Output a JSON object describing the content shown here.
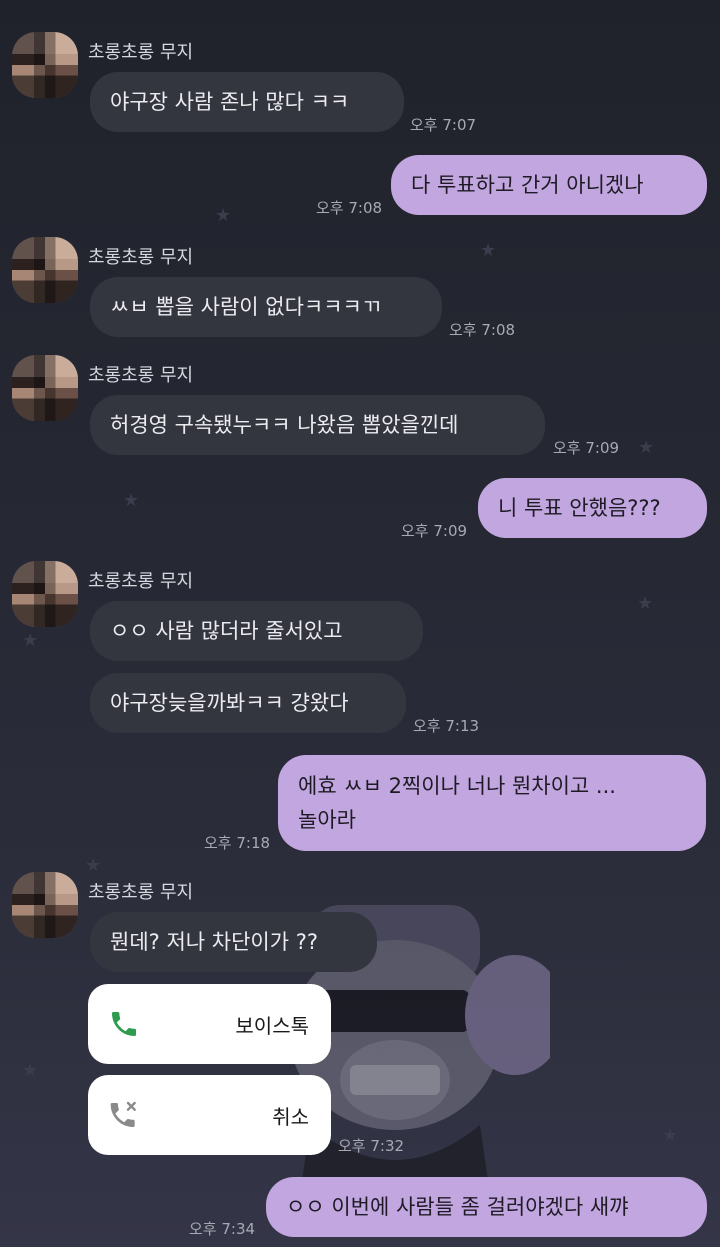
{
  "sender_name": "초롱초롱 무지",
  "messages": [
    {
      "text": "야구장 사람 존나 많다 ㅋㅋ",
      "time": "오후 7:07"
    },
    {
      "text": "다 투표하고 간거 아니겠나",
      "time": "오후 7:08"
    },
    {
      "text": "ㅆㅂ 뽑을 사람이 없다ㅋㅋㅋㄲ",
      "time": "오후 7:08"
    },
    {
      "text": "허경영 구속됐누ㅋㅋ  나왔음 뽑았을낀데",
      "time": "오후 7:09"
    },
    {
      "text": "니 투표 안했음???",
      "time": "오후 7:09"
    },
    {
      "text": "ㅇㅇ  사람 많더라 줄서있고"
    },
    {
      "text": "야구장늦을까봐ㅋㅋ 걍왔다",
      "time": "오후 7:13"
    },
    {
      "line1": "에효  ㅆㅂ  2찍이나 너나  뭔차이고 ...",
      "line2": "놀아라",
      "time": "오후 7:18"
    },
    {
      "text": "뭔데?  저나 차단이가 ??"
    },
    {
      "text": "ㅇㅇ 이번에 사람들 좀 걸러야겠다  새꺄",
      "time": "오후 7:34"
    }
  ],
  "calls": [
    {
      "label": "보이스톡",
      "icon": "phone-icon",
      "color": "#2e9b4f"
    },
    {
      "label": "취소",
      "icon": "missed-call-icon",
      "color": "#8a8a8a"
    }
  ],
  "calls_time": "오후 7:32"
}
